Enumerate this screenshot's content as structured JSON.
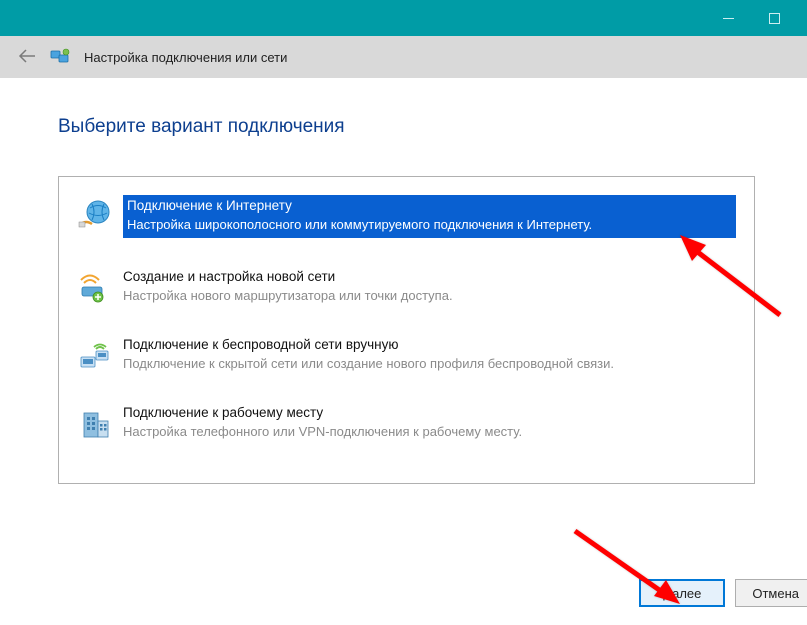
{
  "header": {
    "title": "Настройка подключения или сети"
  },
  "main": {
    "heading": "Выберите вариант подключения",
    "options": [
      {
        "title": "Подключение к Интернету",
        "desc": "Настройка широкополосного или коммутируемого подключения к Интернету."
      },
      {
        "title": "Создание и настройка новой сети",
        "desc": "Настройка нового маршрутизатора или точки доступа."
      },
      {
        "title": "Подключение к беспроводной сети вручную",
        "desc": "Подключение к скрытой сети или создание нового профиля беспроводной связи."
      },
      {
        "title": "Подключение к рабочему месту",
        "desc": "Настройка телефонного или VPN-подключения к рабочему месту."
      }
    ]
  },
  "footer": {
    "next": "Далее",
    "cancel": "Отмена"
  }
}
